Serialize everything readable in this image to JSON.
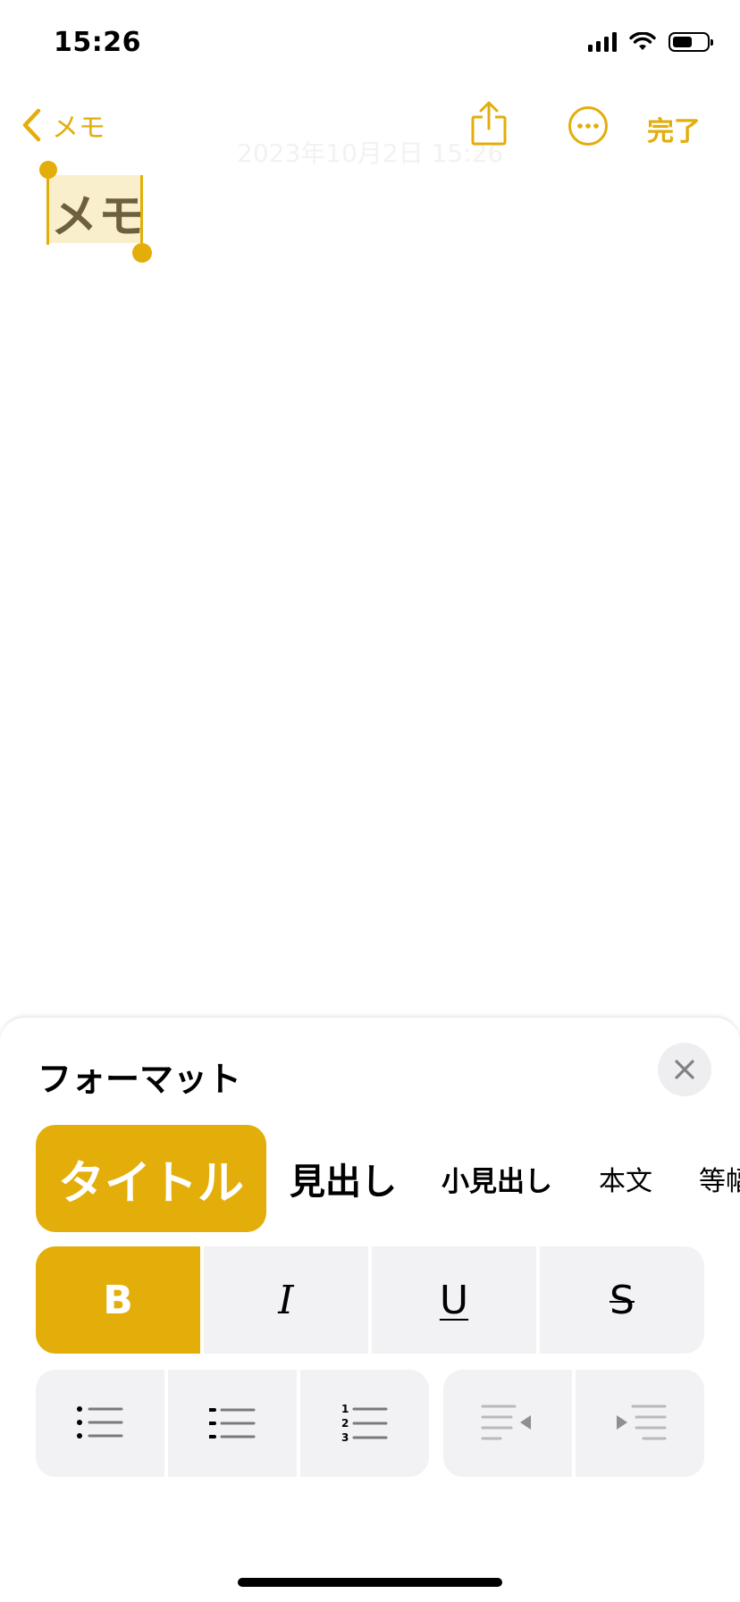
{
  "status_bar": {
    "time": "15:26"
  },
  "nav": {
    "back_label": "メモ",
    "date": "2023年10月2日 15:26",
    "done_label": "完了"
  },
  "note": {
    "title": "メモ"
  },
  "format_sheet": {
    "title": "フォーマット",
    "styles": [
      "タイトル",
      "見出し",
      "小見出し",
      "本文",
      "等幅"
    ],
    "selected_style": "タイトル",
    "text_styles": {
      "bold": "B",
      "italic": "I",
      "underline": "U",
      "strikethrough": "S"
    },
    "active_text_style": "bold"
  },
  "colors": {
    "accent": "#E3AE0A",
    "button_bg": "#F2F2F4",
    "selection": "#FAEFCC"
  }
}
